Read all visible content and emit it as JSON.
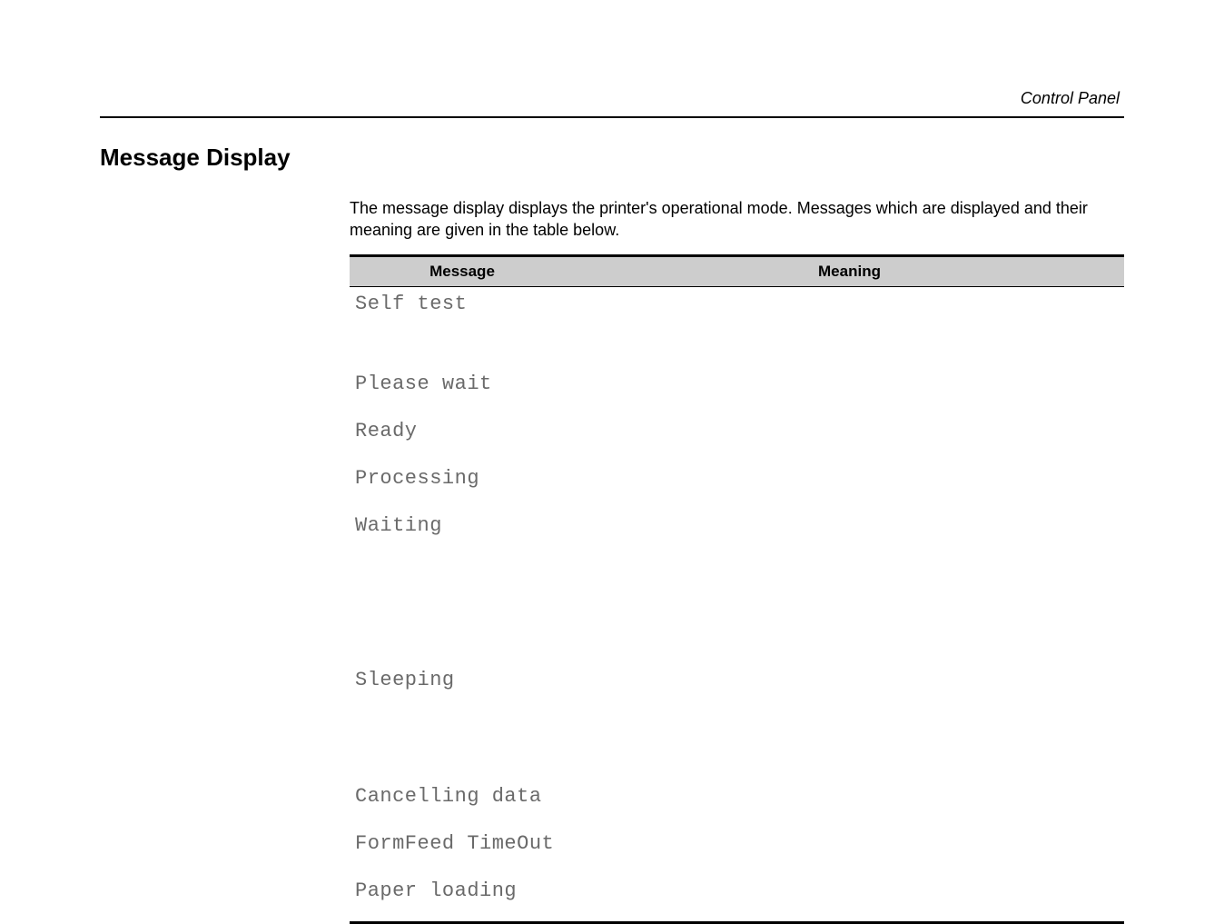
{
  "header": {
    "section": "Control Panel"
  },
  "section": {
    "title": "Message Display",
    "intro": "The message display displays the printer's operational mode.  Messages which are displayed and their meaning are given in the table below."
  },
  "table": {
    "headers": {
      "message": "Message",
      "meaning": "Meaning"
    },
    "rows": [
      {
        "message": "Self test",
        "meaning": ""
      },
      {
        "message": "Please wait",
        "meaning": ""
      },
      {
        "message": "Ready",
        "meaning": ""
      },
      {
        "message": "Processing",
        "meaning": ""
      },
      {
        "message": "Waiting",
        "meaning": ""
      },
      {
        "message": "Sleeping",
        "meaning": ""
      },
      {
        "message": "Cancelling data",
        "meaning": ""
      },
      {
        "message": "FormFeed TimeOut",
        "meaning": ""
      },
      {
        "message": "Paper loading",
        "meaning": ""
      }
    ]
  }
}
